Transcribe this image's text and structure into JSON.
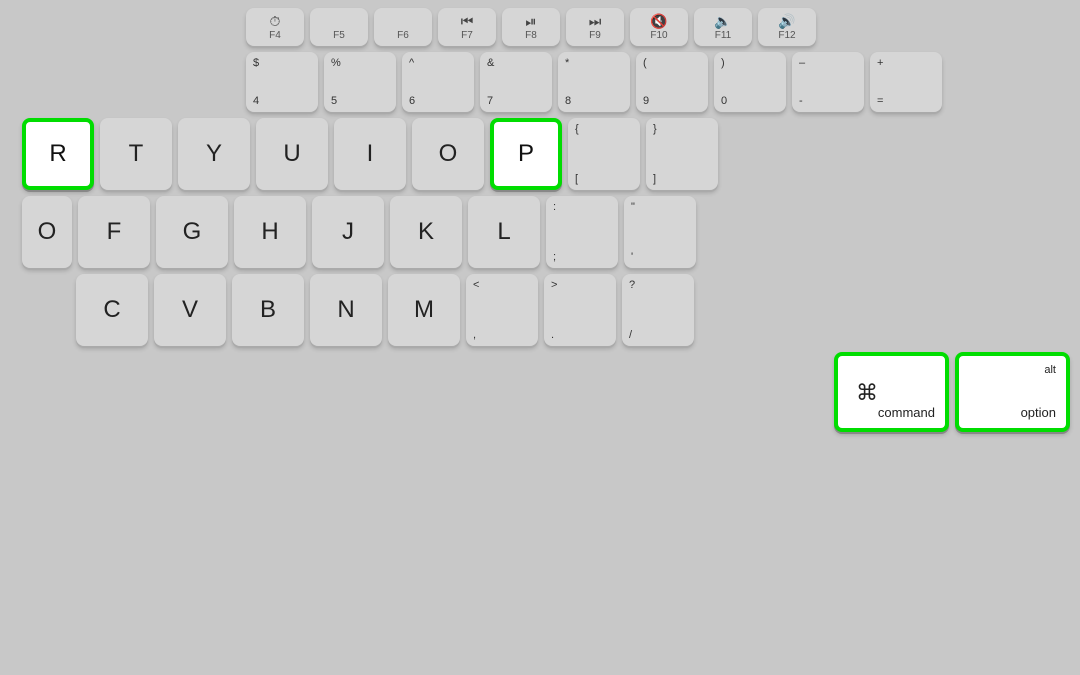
{
  "keyboard": {
    "background": "#c8c8c8",
    "rows": {
      "fn_row": {
        "keys": [
          {
            "id": "f4",
            "top": "⏱",
            "bottom": "F4",
            "type": "fn"
          },
          {
            "id": "f5",
            "top": "",
            "bottom": "F5",
            "type": "fn"
          },
          {
            "id": "f6",
            "top": "",
            "bottom": "F6",
            "type": "fn"
          },
          {
            "id": "f7",
            "top": "◀◀",
            "bottom": "F7",
            "type": "fn"
          },
          {
            "id": "f8",
            "top": "▶‖",
            "bottom": "F8",
            "type": "fn"
          },
          {
            "id": "f9",
            "top": "▶▶",
            "bottom": "F9",
            "type": "fn"
          },
          {
            "id": "f10",
            "top": "◀",
            "bottom": "F10",
            "type": "fn"
          },
          {
            "id": "f11",
            "top": "🔈",
            "bottom": "F11",
            "type": "fn"
          },
          {
            "id": "f12",
            "top": "🔊",
            "bottom": "F12",
            "type": "fn"
          }
        ]
      },
      "num_row": {
        "keys": [
          {
            "id": "4",
            "top": "$",
            "bottom": "4"
          },
          {
            "id": "5",
            "top": "%",
            "bottom": "5"
          },
          {
            "id": "6",
            "top": "^",
            "bottom": "6"
          },
          {
            "id": "7",
            "top": "&",
            "bottom": "7"
          },
          {
            "id": "8",
            "top": "*",
            "bottom": "8"
          },
          {
            "id": "9",
            "top": "(",
            "bottom": "9"
          },
          {
            "id": "0",
            "top": ")",
            "bottom": "0"
          },
          {
            "id": "minus",
            "top": "–",
            "bottom": "-"
          },
          {
            "id": "plus",
            "top": "+",
            "bottom": "="
          }
        ]
      },
      "qwerty_row": {
        "keys": [
          {
            "id": "R",
            "label": "R",
            "highlight": true
          },
          {
            "id": "T",
            "label": "T"
          },
          {
            "id": "Y",
            "label": "Y"
          },
          {
            "id": "U",
            "label": "U"
          },
          {
            "id": "I",
            "label": "I"
          },
          {
            "id": "O",
            "label": "O"
          },
          {
            "id": "P",
            "label": "P",
            "highlight": true
          },
          {
            "id": "bracket_l",
            "top": "{",
            "bottom": "["
          },
          {
            "id": "bracket_r",
            "top": "}",
            "bottom": "]"
          }
        ]
      },
      "home_row": {
        "keys": [
          {
            "id": "O_partial",
            "label": "O"
          },
          {
            "id": "F",
            "label": "F"
          },
          {
            "id": "G",
            "label": "G"
          },
          {
            "id": "H",
            "label": "H"
          },
          {
            "id": "J",
            "label": "J"
          },
          {
            "id": "K",
            "label": "K"
          },
          {
            "id": "L",
            "label": "L"
          },
          {
            "id": "semicolon",
            "top": ":",
            "bottom": ";"
          },
          {
            "id": "quote",
            "top": "\"",
            "bottom": "'"
          }
        ]
      },
      "bottom_letters": {
        "keys": [
          {
            "id": "C",
            "label": "C"
          },
          {
            "id": "V",
            "label": "V"
          },
          {
            "id": "B",
            "label": "B"
          },
          {
            "id": "N",
            "label": "N"
          },
          {
            "id": "M",
            "label": "M"
          },
          {
            "id": "comma",
            "top": "<",
            "bottom": ","
          },
          {
            "id": "period",
            "top": ">",
            "bottom": "."
          },
          {
            "id": "slash",
            "top": "?",
            "bottom": "/"
          }
        ]
      },
      "modifier_row": {
        "command": {
          "symbol": "⌘",
          "label": "command",
          "highlight": true
        },
        "option": {
          "alt": "alt",
          "label": "option",
          "highlight": true
        }
      }
    }
  }
}
